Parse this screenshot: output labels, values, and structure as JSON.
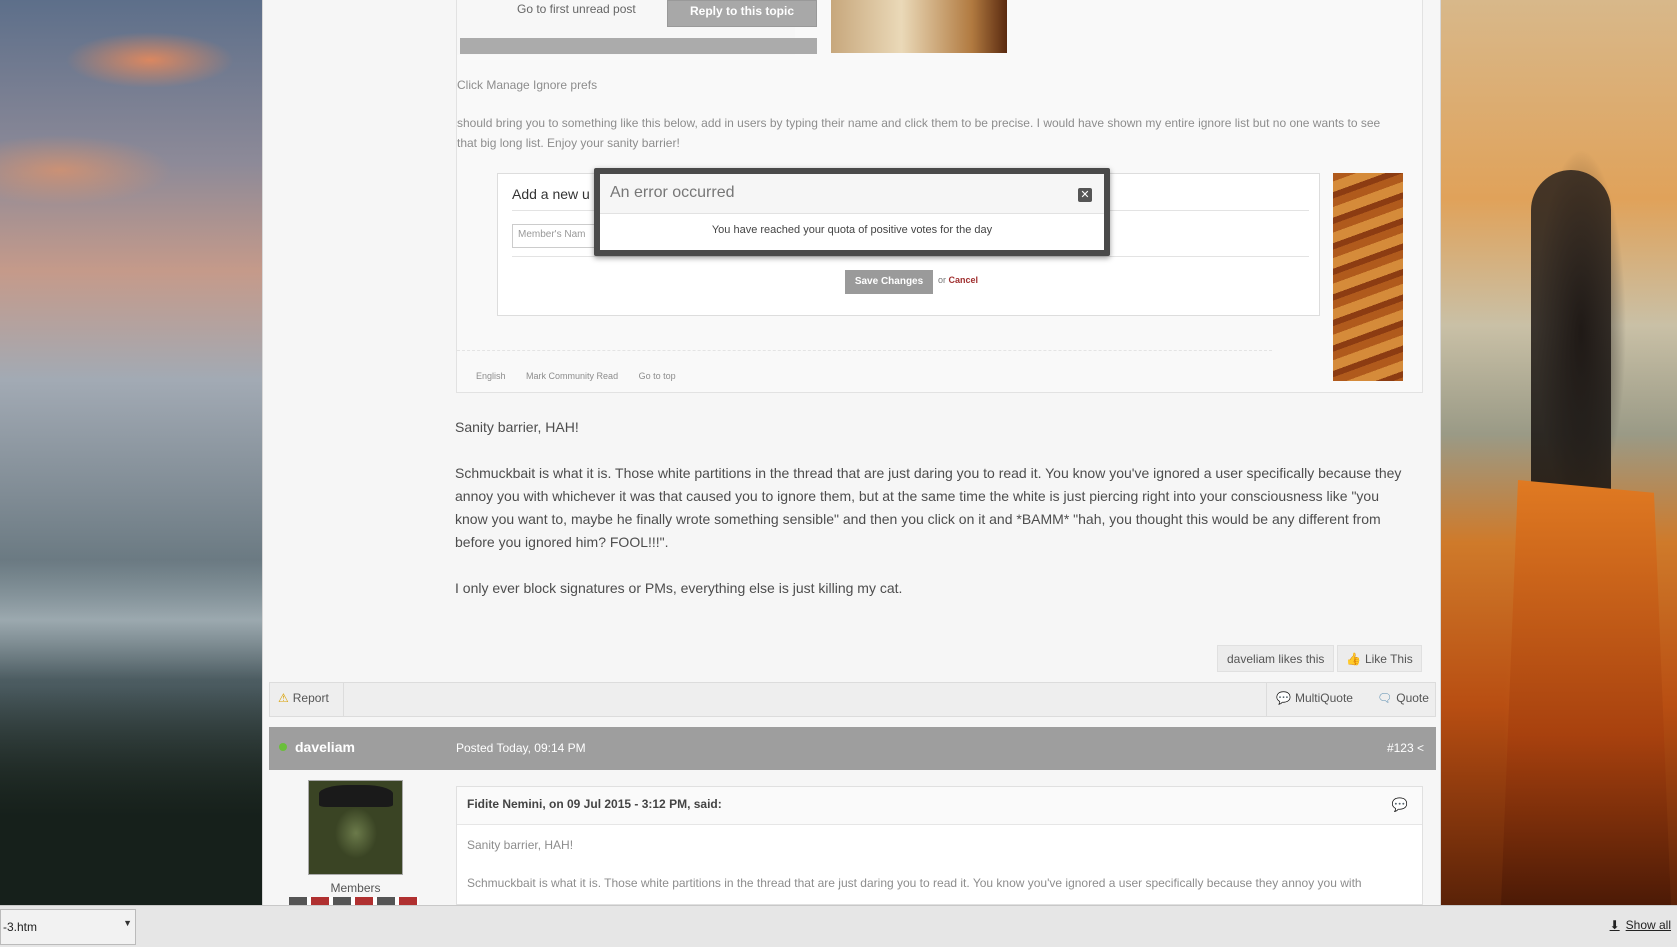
{
  "embedded_screenshot": {
    "first_unread": "Go to first unread post",
    "reply_button": "Reply to this topic",
    "click_manage": "Click Manage Ignore prefs",
    "instructions": "should bring you to something like this below, add in users by typing their name and click them to be precise. I would have shown my entire ignore list but no one wants to see that big long list. Enjoy your sanity barrier!",
    "panel_title": "Add a new u",
    "member_placeholder": "Member's Nam",
    "save_changes": "Save Changes",
    "or_text": "or",
    "cancel": "Cancel",
    "footer_links": [
      "English",
      "Mark Community Read",
      "Go to top"
    ]
  },
  "error_modal": {
    "title": "An error occurred",
    "message": "You have reached your quota of positive votes for the day"
  },
  "post": {
    "paragraphs": [
      "Sanity barrier, HAH!",
      "Schmuckbait is what it is. Those white partitions in the thread that are just daring you to read it. You know you've ignored a user specifically because they annoy you with whichever it was that caused you to ignore them, but at the same time the white is just piercing right into your consciousness like \"you know you want to, maybe he finally wrote something sensible\" and then you click on it and *BAMM* \"hah, you thought this would be any different from before you ignored him? FOOL!!!\".",
      "I only ever block signatures or PMs, everything else is just killing my cat."
    ],
    "likes_text": "daveliam likes this",
    "like_button": "Like This"
  },
  "controls": {
    "report": "Report",
    "multiquote": "MultiQuote",
    "quote": "Quote"
  },
  "next_post": {
    "author": "daveliam",
    "posted": "Posted Today, 09:14 PM",
    "number": "#123",
    "group": "Members",
    "quote_cite": "Fidite Nemini, on 09 Jul 2015 - 3:12 PM, said:",
    "quote_line1": "Sanity barrier, HAH!",
    "quote_line2": "Schmuckbait is what it is. Those white partitions in the thread that are just daring you to read it. You know you've ignored a user specifically because they annoy you with"
  },
  "download_bar": {
    "file": "-3.htm",
    "show_all": "Show all"
  }
}
